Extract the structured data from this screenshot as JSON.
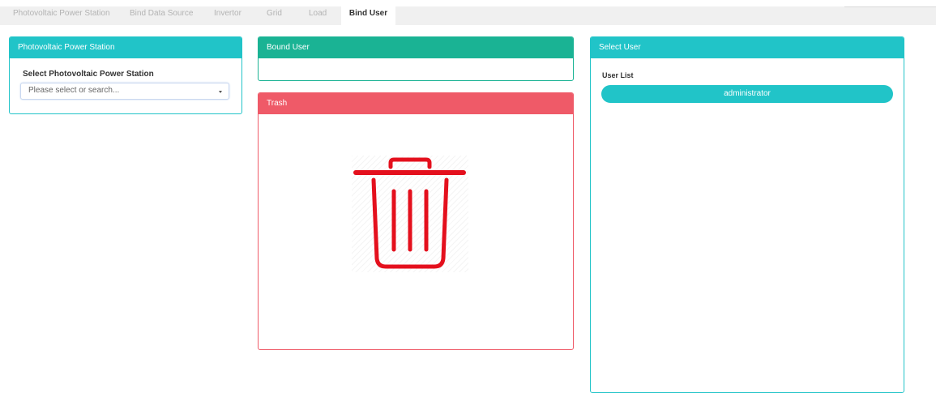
{
  "tabs": [
    {
      "label": "Photovoltaic Power Station",
      "active": false
    },
    {
      "label": "Bind Data Source",
      "active": false
    },
    {
      "label": "Invertor",
      "active": false
    },
    {
      "label": "Grid",
      "active": false
    },
    {
      "label": "Load",
      "active": false
    },
    {
      "label": "Bind User",
      "active": true
    }
  ],
  "station_panel": {
    "title": "Photovoltaic Power Station",
    "select_label": "Select Photovoltaic Power Station",
    "select_placeholder": "Please select or search..."
  },
  "bound_panel": {
    "title": "Bound User"
  },
  "trash_panel": {
    "title": "Trash",
    "icon": "trash-icon"
  },
  "select_panel": {
    "title": "Select User",
    "list_label": "User List",
    "users": [
      "administrator"
    ]
  },
  "colors": {
    "teal": "#21c4c8",
    "green": "#1ab394",
    "red": "#ef5a68",
    "trash_icon": "#e4101d"
  }
}
